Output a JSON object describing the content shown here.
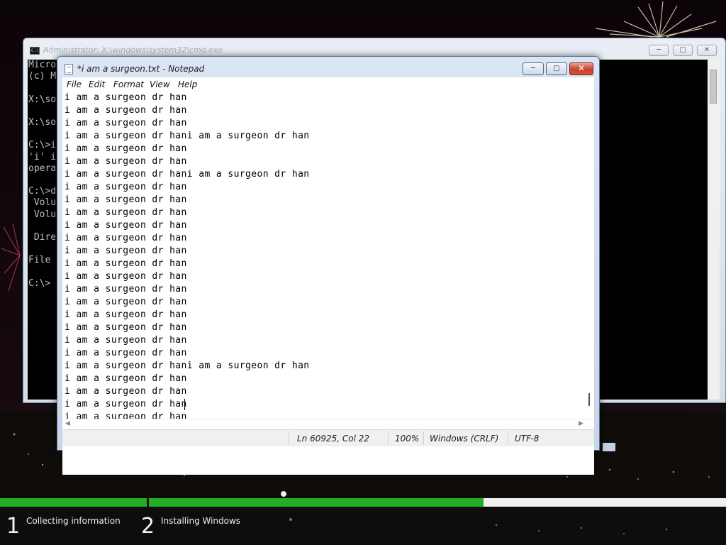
{
  "cmd_window": {
    "title": "Administrator: X:\\windows\\system32\\cmd.exe",
    "console_lines": [
      "Micro",
      "(c) M",
      "",
      "X:\\so",
      "",
      "X:\\so",
      "",
      "C:\\>i",
      "'i' i",
      "opera",
      "",
      "C:\\>d",
      " Volu",
      " Volu",
      "",
      " Dire",
      "",
      "File",
      "",
      "C:\\>"
    ]
  },
  "notepad": {
    "title": "*i am a surgeon.txt - Notepad",
    "menu": [
      "File",
      "Edit",
      "Format",
      "View",
      "Help"
    ],
    "lines": [
      "i am a surgeon dr han",
      "i am a surgeon dr han",
      "i am a surgeon dr han",
      "i am a surgeon dr hani am a surgeon dr han",
      "i am a surgeon dr han",
      "i am a surgeon dr han",
      "i am a surgeon dr hani am a surgeon dr han",
      "i am a surgeon dr han",
      "i am a surgeon dr han",
      "i am a surgeon dr han",
      "i am a surgeon dr han",
      "i am a surgeon dr han",
      "i am a surgeon dr han",
      "i am a surgeon dr han",
      "i am a surgeon dr han",
      "i am a surgeon dr han",
      "i am a surgeon dr han",
      "i am a surgeon dr han",
      "i am a surgeon dr han",
      "i am a surgeon dr han",
      "i am a surgeon dr han",
      "i am a surgeon dr hani am a surgeon dr han",
      "i am a surgeon dr han",
      "i am a surgeon dr han",
      "i am a surgeon dr han",
      "i am a surgeon dr han"
    ],
    "status": {
      "position": "Ln 60925, Col 22",
      "zoom": "100%",
      "line_ending": "Windows (CRLF)",
      "encoding": "UTF-8"
    }
  },
  "setup_progress": {
    "steps": [
      {
        "number": "1",
        "label": "Collecting information",
        "progress": 1.0
      },
      {
        "number": "2",
        "label": "Installing Windows",
        "progress": 0.58
      }
    ],
    "accent_color": "#21b024"
  }
}
